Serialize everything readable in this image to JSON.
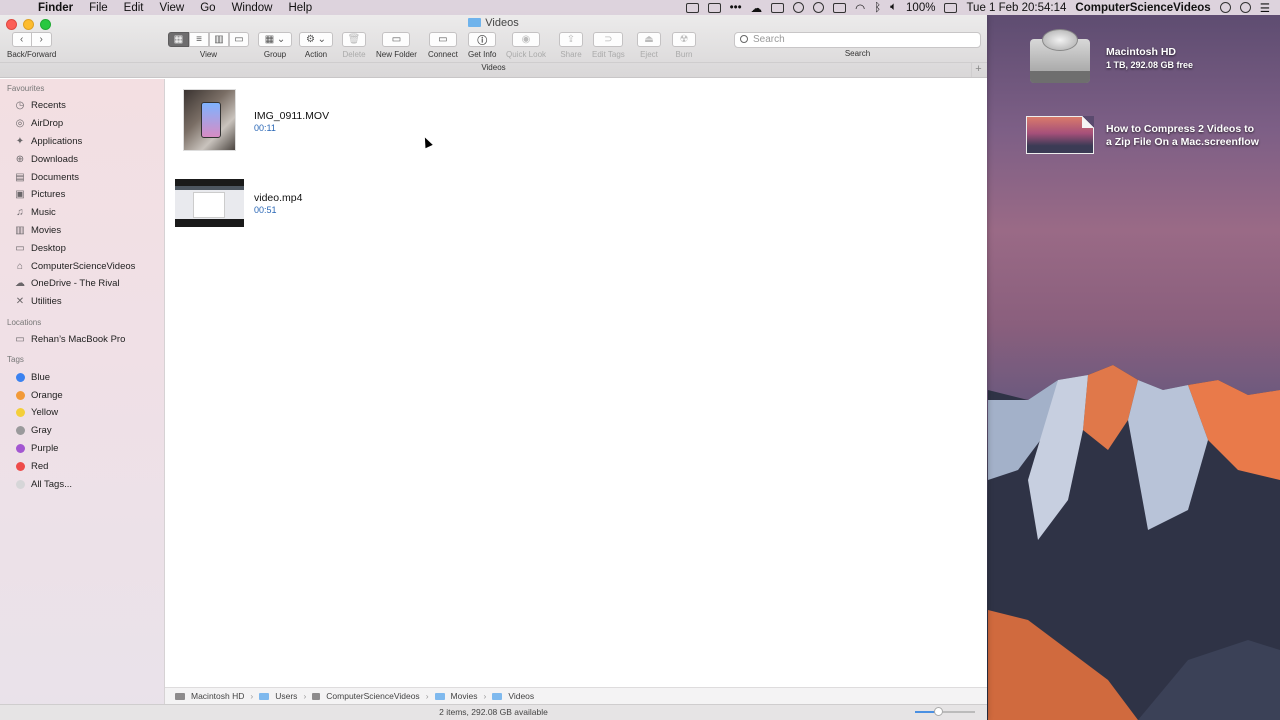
{
  "menubar": {
    "app": "Finder",
    "items": [
      "File",
      "Edit",
      "View",
      "Go",
      "Window",
      "Help"
    ],
    "battery": "100%",
    "clock": "Tue 1 Feb  20:54:14",
    "user": "ComputerScienceVideos"
  },
  "window": {
    "title": "Videos",
    "back_forward_label": "Back/Forward",
    "toolbar": {
      "view": "View",
      "group": "Group",
      "action": "Action",
      "delete": "Delete",
      "new_folder": "New Folder",
      "connect": "Connect",
      "get_info": "Get Info",
      "quick_look": "Quick Look",
      "share": "Share",
      "edit_tags": "Edit Tags",
      "eject": "Eject",
      "burn": "Burn",
      "search_placeholder": "Search",
      "search_label": "Search"
    },
    "path_title": "Videos"
  },
  "sidebar": {
    "favourites_header": "Favourites",
    "favourites": [
      {
        "label": "Recents",
        "icon": "clock-icon"
      },
      {
        "label": "AirDrop",
        "icon": "airdrop-icon"
      },
      {
        "label": "Applications",
        "icon": "applications-icon"
      },
      {
        "label": "Downloads",
        "icon": "download-icon"
      },
      {
        "label": "Documents",
        "icon": "document-icon"
      },
      {
        "label": "Pictures",
        "icon": "camera-icon"
      },
      {
        "label": "Music",
        "icon": "music-icon"
      },
      {
        "label": "Movies",
        "icon": "film-icon"
      },
      {
        "label": "Desktop",
        "icon": "desktop-icon"
      },
      {
        "label": "ComputerScienceVideos",
        "icon": "home-icon"
      },
      {
        "label": "OneDrive - The Rival",
        "icon": "cloud-icon"
      },
      {
        "label": "Utilities",
        "icon": "tools-icon"
      }
    ],
    "locations_header": "Locations",
    "locations": [
      {
        "label": "Rehan’s MacBook Pro",
        "icon": "laptop-icon"
      }
    ],
    "tags_header": "Tags",
    "tags": [
      {
        "label": "Blue",
        "color": "#3b82f0"
      },
      {
        "label": "Orange",
        "color": "#f29a38"
      },
      {
        "label": "Yellow",
        "color": "#f4cf3a"
      },
      {
        "label": "Gray",
        "color": "#9a9a9c"
      },
      {
        "label": "Purple",
        "color": "#a357d1"
      },
      {
        "label": "Red",
        "color": "#ee4b4a"
      },
      {
        "label": "All Tags...",
        "color": "#d6d6d8"
      }
    ]
  },
  "files": [
    {
      "name": "IMG_0911.MOV",
      "duration": "00:11"
    },
    {
      "name": "video.mp4",
      "duration": "00:51"
    }
  ],
  "pathbar": [
    "Macintosh HD",
    "Users",
    "ComputerScienceVideos",
    "Movies",
    "Videos"
  ],
  "status": "2 items, 292.08 GB available",
  "desktop": {
    "disk_name": "Macintosh HD",
    "disk_info": "1 TB, 292.08 GB free",
    "file_line1": "How to Compress 2 Videos to",
    "file_line2": "a Zip File On a Mac.screenflow"
  }
}
